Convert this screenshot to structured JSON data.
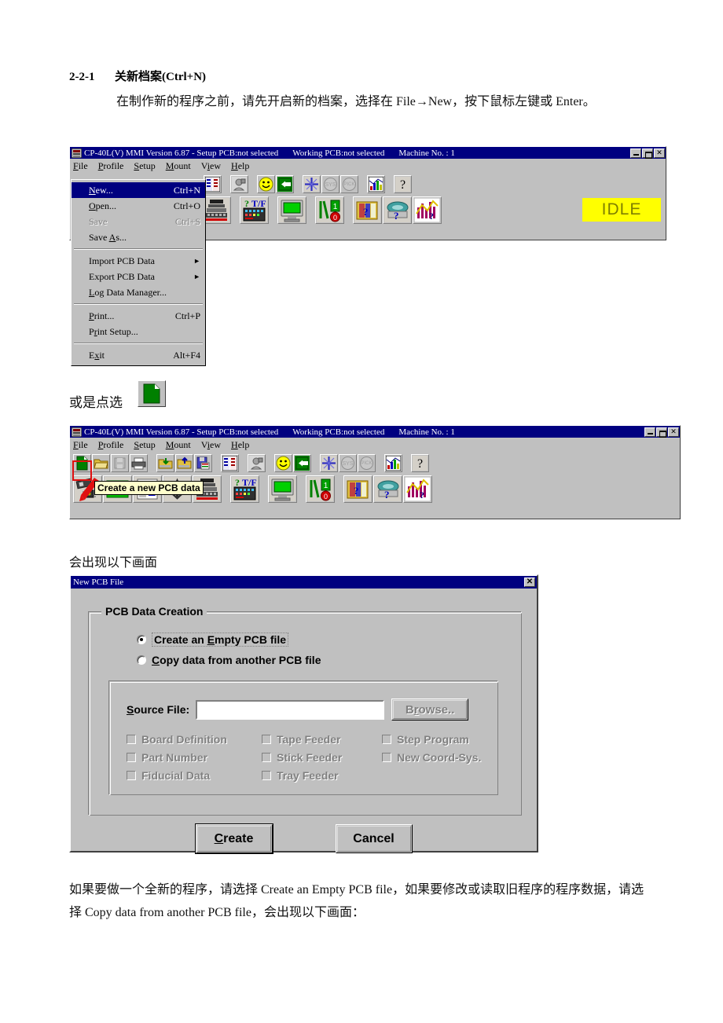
{
  "document": {
    "section_number": "2-2-1",
    "section_title": "关新档案(Ctrl+N)",
    "paragraph_1": "在制作新的程序之前，请先开启新的档案，选择在 File→New，按下鼠标左键或 Enter。",
    "caption_click": "或是点选",
    "caption_screen": "会出现以下画面",
    "paragraph_last": "如果要做一个全新的程序，请选择 Create an Empty PCB file，如果要修改或读取旧程序的程序数据，请选择 Copy data from another PCB file，会出现以下画面："
  },
  "app_window": {
    "title_main": "CP-40L(V) MMI Version 6.87 - Setup PCB:not selected",
    "title_working": "Working PCB:not selected",
    "title_machine": "Machine No. : 1",
    "window_buttons": {
      "minimize": "_",
      "restore": "",
      "close": "✕"
    },
    "menus": [
      {
        "label": "File",
        "mnemonic": "F"
      },
      {
        "label": "Profile",
        "mnemonic": "P"
      },
      {
        "label": "Setup",
        "mnemonic": "S"
      },
      {
        "label": "Mount",
        "mnemonic": "M"
      },
      {
        "label": "View",
        "mnemonic": "i"
      },
      {
        "label": "Help",
        "mnemonic": "H"
      }
    ],
    "status_indicator": "IDLE",
    "status_color": "#ffff00"
  },
  "file_menu": {
    "items": [
      {
        "label": "New...",
        "accel": "Ctrl+N",
        "state": "selected",
        "submenu": false
      },
      {
        "label": "Open...",
        "accel": "Ctrl+O",
        "state": "normal",
        "submenu": false
      },
      {
        "label": "Save",
        "accel": "Ctrl+S",
        "state": "disabled",
        "submenu": false
      },
      {
        "label": "Save As...",
        "accel": "",
        "state": "normal",
        "submenu": false
      },
      {
        "separator": true
      },
      {
        "label": "Import PCB Data",
        "accel": "",
        "state": "normal",
        "submenu": true
      },
      {
        "label": "Export PCB Data",
        "accel": "",
        "state": "normal",
        "submenu": true
      },
      {
        "label": "Log Data Manager...",
        "accel": "",
        "state": "normal",
        "submenu": false
      },
      {
        "separator": true
      },
      {
        "label": "Print...",
        "accel": "Ctrl+P",
        "state": "normal",
        "submenu": false
      },
      {
        "label": "Print Setup...",
        "accel": "",
        "state": "normal",
        "submenu": false
      },
      {
        "separator": true
      },
      {
        "label": "Exit",
        "accel": "Alt+F4",
        "state": "normal",
        "submenu": false
      }
    ]
  },
  "toolbar": {
    "row1_icons": [
      "new-file-icon",
      "open-folder-icon",
      "save-disabled-icon",
      "print-icon",
      "import-pcb-icon",
      "export-pcb-icon",
      "save-pcb-icon",
      "board-layout-icon",
      "teach-icon",
      "smiley-icon",
      "exit-door-icon",
      "origin-cross-icon",
      "sys-icon",
      "pick-icon",
      "graph-report-icon",
      "help-question-icon"
    ],
    "row2_icons": [
      "camera-chip-icon",
      "nozzle-green-icon",
      "feeder-L-icon",
      "tweezer-icon",
      "head-stack-icon",
      "tf-keypad-icon",
      "monitor-icon",
      "switch-light-icon",
      "library-query-icon",
      "tray-query-icon",
      "chart-query-icon"
    ],
    "tooltip_text": "Create a new PCB data",
    "highlight_color": "#e01010"
  },
  "dialog": {
    "title": "New PCB File",
    "close_label": "✕",
    "group_label": "PCB Data Creation",
    "radios": [
      {
        "label": "Create an Empty PCB file",
        "mnemonic": "E",
        "checked": true,
        "focused": true
      },
      {
        "label": "Copy data from another PCB file",
        "mnemonic": "C",
        "checked": false,
        "focused": false
      }
    ],
    "source_file": {
      "label": "Source File:",
      "mnemonic": "S",
      "value": "",
      "placeholder": ""
    },
    "browse_button": {
      "label": "Browse..",
      "enabled": false
    },
    "checkbox_columns": [
      [
        {
          "label": "Board Definition",
          "checked": false,
          "enabled": false
        },
        {
          "label": "Part Number",
          "checked": false,
          "enabled": false
        },
        {
          "label": "Fiducial Data",
          "checked": false,
          "enabled": false
        }
      ],
      [
        {
          "label": "Tape Feeder",
          "checked": false,
          "enabled": false
        },
        {
          "label": "Stick Feeder",
          "checked": false,
          "enabled": false
        },
        {
          "label": "Tray Feeder",
          "checked": false,
          "enabled": false
        }
      ],
      [
        {
          "label": "Step Program",
          "checked": false,
          "enabled": false
        },
        {
          "label": "New Coord-Sys.",
          "checked": false,
          "enabled": false
        }
      ]
    ],
    "buttons": [
      {
        "label": "Create",
        "mnemonic": "C",
        "default": true
      },
      {
        "label": "Cancel",
        "mnemonic": "",
        "default": false
      }
    ]
  }
}
